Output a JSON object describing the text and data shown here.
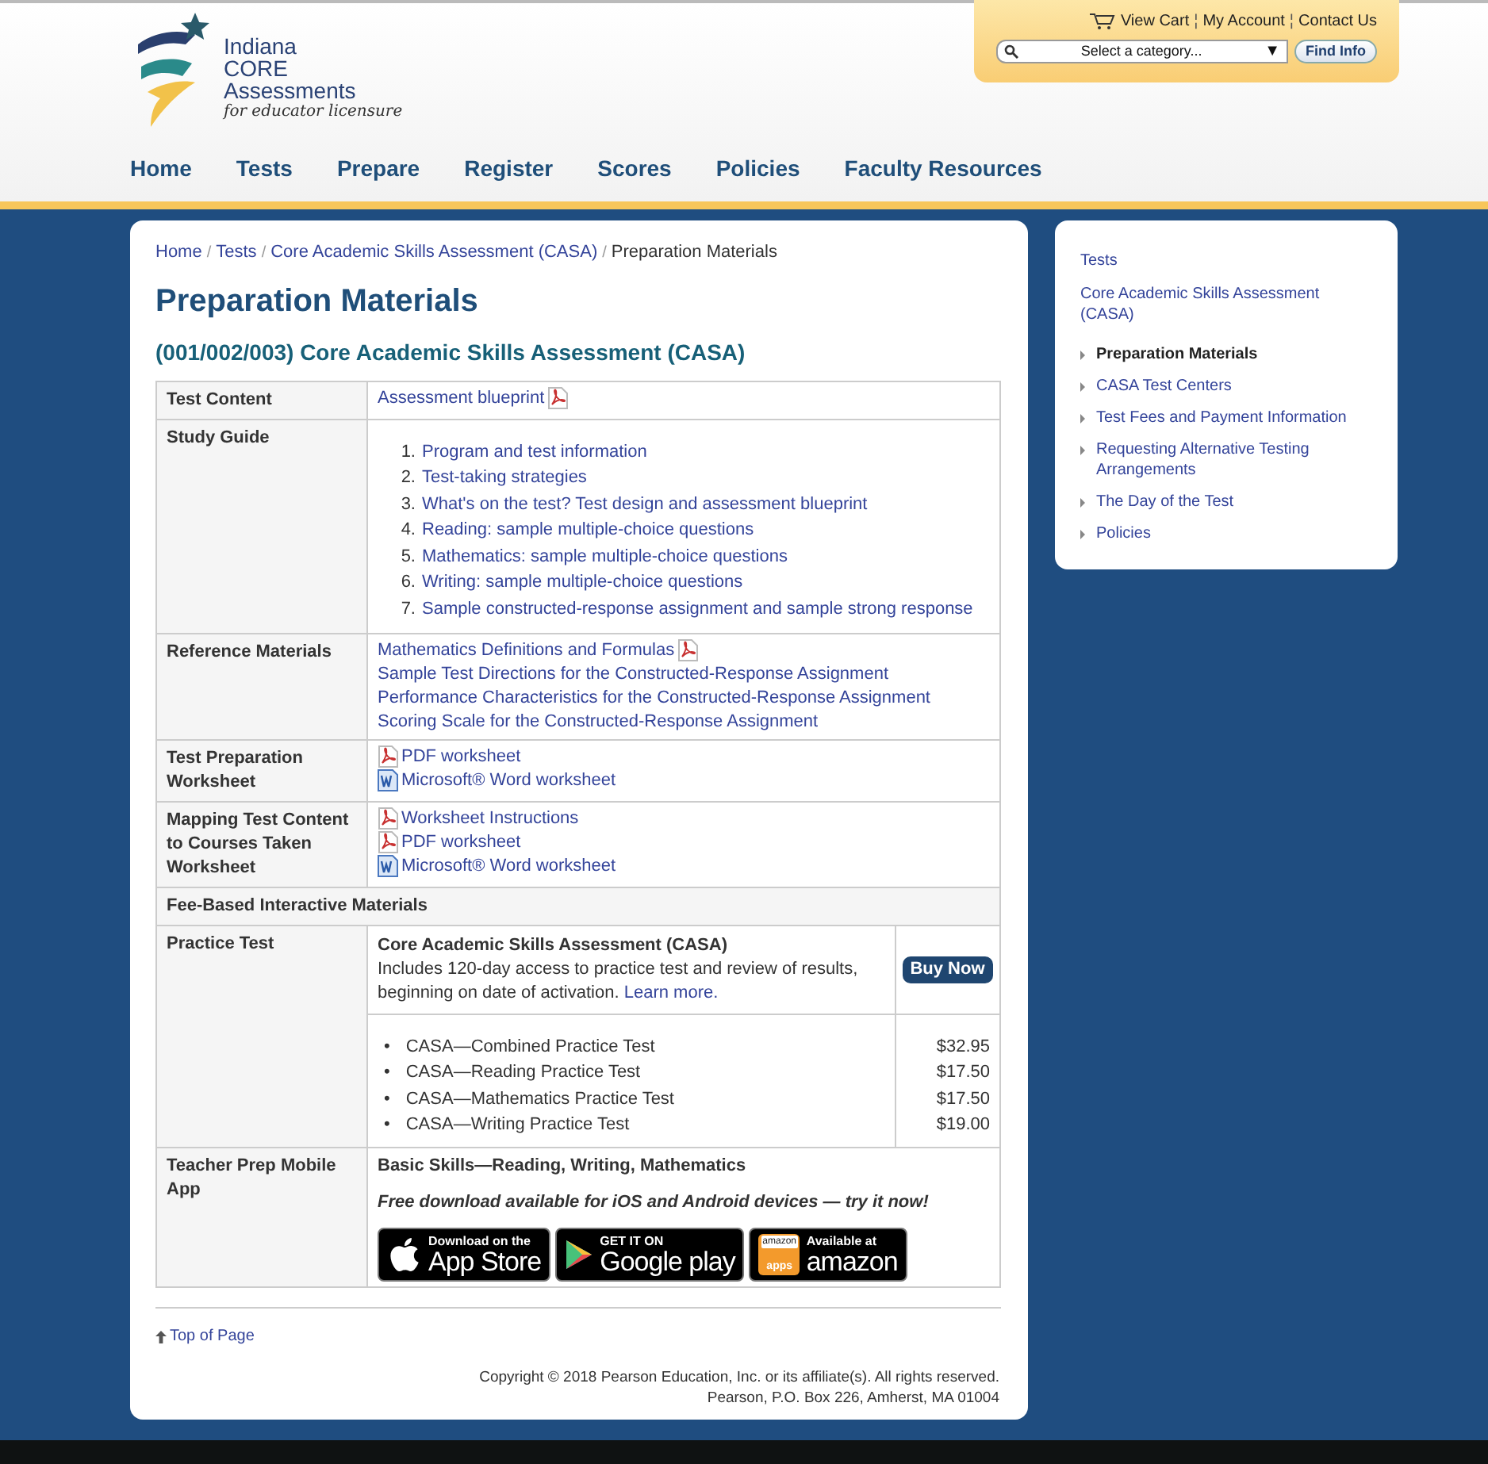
{
  "logo": {
    "lines": [
      "Indiana",
      "CORE",
      "Assessments"
    ],
    "tagline": "for educator licensure"
  },
  "utility_links": [
    "View Cart",
    "My Account",
    "Contact Us"
  ],
  "utility_separator": "¦",
  "category_select": {
    "value": "Select a category...",
    "caret": "▼"
  },
  "find_button": "Find Info",
  "nav": [
    "Home",
    "Tests",
    "Prepare",
    "Register",
    "Scores",
    "Policies",
    "Faculty Resources"
  ],
  "breadcrumb": {
    "separator": "/",
    "items": [
      "Home",
      "Tests",
      "Core Academic Skills Assessment (CASA)"
    ],
    "current": "Preparation Materials"
  },
  "title": "Preparation Materials",
  "subtitle": "(001/002/003) Core Academic Skills Assessment (CASA)",
  "table": [
    {
      "kind": "links",
      "label": "Test Content",
      "items": [
        {
          "text": "Assessment blueprint",
          "kind": "pdf_after"
        }
      ]
    },
    {
      "kind": "ordered",
      "label": "Study Guide",
      "items": [
        {
          "number": "1.",
          "text": "Program and test information"
        },
        {
          "number": "2.",
          "text": "Test-taking strategies"
        },
        {
          "number": "3.",
          "text": "What's on the test? Test design and assessment blueprint"
        },
        {
          "number": "4.",
          "text": "Reading: sample multiple-choice questions"
        },
        {
          "number": "5.",
          "text": "Mathematics: sample multiple-choice questions"
        },
        {
          "number": "6.",
          "text": "Writing: sample multiple-choice questions"
        },
        {
          "number": "7.",
          "text": "Sample constructed-response assignment and sample strong response"
        }
      ]
    },
    {
      "kind": "links",
      "label": "Reference Materials",
      "items": [
        {
          "text": "Mathematics Definitions and Formulas",
          "kind": "pdf_after"
        },
        {
          "text": "Sample Test Directions for the Constructed-Response Assignment"
        },
        {
          "text": "Performance Characteristics for the Constructed-Response Assignment"
        },
        {
          "text": "Scoring Scale for the Constructed-Response Assignment"
        }
      ]
    },
    {
      "kind": "links",
      "label": "Test Preparation Worksheet",
      "items": [
        {
          "text": "PDF worksheet",
          "kind": "pdf_before"
        },
        {
          "text": "Microsoft® Word worksheet",
          "kind": "word_before"
        }
      ]
    },
    {
      "kind": "links",
      "label": "Mapping Test Content to Courses Taken Worksheet",
      "items": [
        {
          "text": "Worksheet Instructions",
          "kind": "pdf_before"
        },
        {
          "text": "PDF worksheet",
          "kind": "pdf_before"
        },
        {
          "text": "Microsoft® Word worksheet",
          "kind": "word_before"
        }
      ]
    },
    {
      "kind": "section",
      "label": "Fee-Based Interactive Materials"
    },
    {
      "kind": "practice",
      "label": "Practice Test",
      "product": "Core Academic Skills Assessment (CASA)",
      "description": "Includes 120-day access to practice test and review of results, beginning on date of activation.",
      "link": "Learn more.",
      "button": "Buy Now",
      "products": [
        {
          "bullet": "•",
          "name": "CASA—Combined Practice Test",
          "price": "$32.95"
        },
        {
          "bullet": "•",
          "name": "CASA—Reading Practice Test",
          "price": "$17.50"
        },
        {
          "bullet": "•",
          "name": "CASA—Mathematics Practice Test",
          "price": "$17.50"
        },
        {
          "bullet": "•",
          "name": "CASA—Writing Practice Test",
          "price": "$19.00"
        }
      ]
    },
    {
      "kind": "app",
      "label": "Teacher Prep Mobile App",
      "heading": "Basic Skills—Reading, Writing, Mathematics",
      "note": "Free download available for iOS and Android devices — try it now!",
      "badges": [
        {
          "kind": "apple",
          "small": "Download on the",
          "large": "App Store"
        },
        {
          "kind": "google",
          "small": "GET IT ON",
          "large": "Google play"
        },
        {
          "kind": "amazon",
          "small": "Available at",
          "large": "amazon",
          "tile": [
            "amazon",
            "apps"
          ]
        }
      ]
    }
  ],
  "top_link": "Top of Page",
  "copyright": [
    "Copyright © 2018 Pearson Education, Inc. or its affiliate(s). All rights reserved.",
    "Pearson, P.O. Box 226, Amherst, MA 01004"
  ],
  "sidebar": {
    "links": [
      "Tests",
      "Core Academic Skills Assessment (CASA)"
    ],
    "items": [
      {
        "text": "Preparation Materials",
        "selected": true
      },
      {
        "text": "CASA Test Centers",
        "selected": false
      },
      {
        "text": "Test Fees and Payment Information",
        "selected": false
      },
      {
        "text": "Requesting Alternative Testing Arrangements",
        "selected": false
      },
      {
        "text": "The Day of the Test",
        "selected": false
      },
      {
        "text": "Policies",
        "selected": false
      }
    ]
  }
}
